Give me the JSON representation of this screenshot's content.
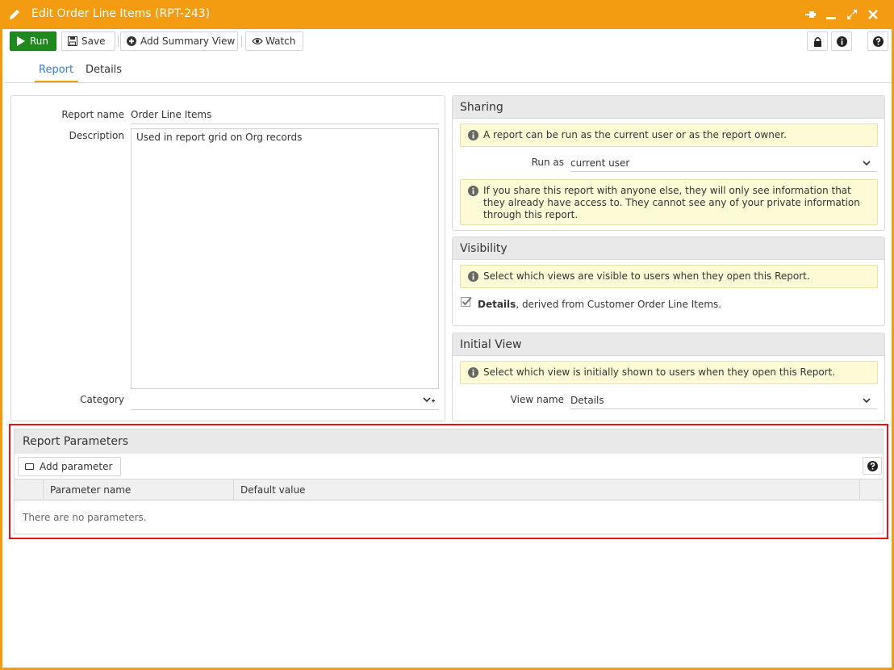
{
  "window": {
    "title": "Edit Order Line Items (RPT-243)",
    "accent_color": "#f39c12",
    "icons": [
      "pencil-icon",
      "pin-icon",
      "minimize-icon",
      "maximize-icon",
      "close-icon"
    ]
  },
  "toolbar": {
    "run_label": "Run",
    "save_label": "Save",
    "add_summary_view_label": "Add Summary View",
    "watch_label": "Watch",
    "run_color": "#1e8a1e",
    "right_icons": [
      "lock-icon",
      "info-icon",
      "help-icon"
    ]
  },
  "tabs": [
    {
      "label": "Report",
      "active": true
    },
    {
      "label": "Details",
      "active": false
    }
  ],
  "report_form": {
    "name_label": "Report name",
    "name_value": "Order Line Items",
    "description_label": "Description",
    "description_value": "Used in report grid on Org records",
    "category_label": "Category",
    "category_value": ""
  },
  "sharing": {
    "title": "Sharing",
    "note": "A report can be run as the current user or as the report owner.",
    "run_as_label": "Run as",
    "run_as_value": "current user",
    "warning": "If you share this report with anyone else, they will only see information that they already have access to. They cannot see any of your private information through this report."
  },
  "visibility": {
    "title": "Visibility",
    "note": "Select which views are visible to users when they open this Report.",
    "view_name": "Details",
    "view_suffix": ", derived from Customer Order Line Items.",
    "view_checked": true
  },
  "initial_view": {
    "title": "Initial View",
    "note": "Select which view is initially shown to users when they open this Report.",
    "view_name_label": "View name",
    "view_name_value": "Details"
  },
  "report_parameters": {
    "title": "Report Parameters",
    "add_label": "Add parameter",
    "columns": [
      "Parameter name",
      "Default value"
    ],
    "rows": [],
    "empty_message": "There are no parameters.",
    "highlight_color": "#e4141a"
  }
}
